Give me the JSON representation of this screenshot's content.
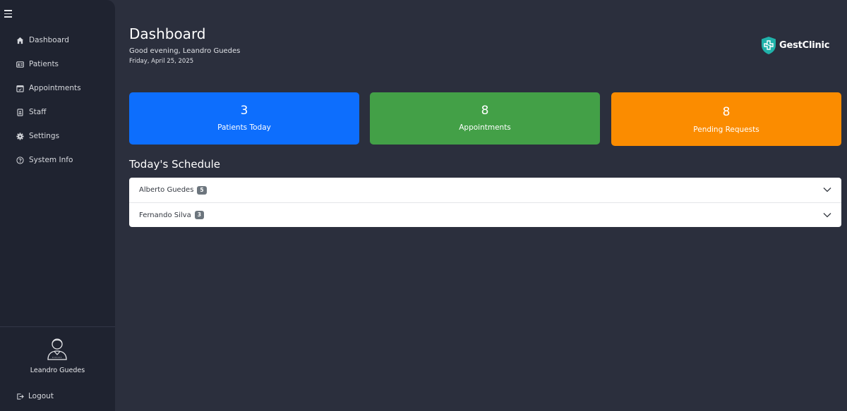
{
  "sidebar": {
    "items": [
      {
        "label": "Dashboard",
        "icon": "home-icon"
      },
      {
        "label": "Patients",
        "icon": "id-card-icon"
      },
      {
        "label": "Appointments",
        "icon": "calendar-icon"
      },
      {
        "label": "Staff",
        "icon": "badge-icon"
      },
      {
        "label": "Settings",
        "icon": "gear-icon"
      },
      {
        "label": "System Info",
        "icon": "help-circle-icon"
      }
    ],
    "user": {
      "name": "Leandro Guedes"
    },
    "logout_label": "Logout"
  },
  "header": {
    "title": "Dashboard",
    "greeting": "Good evening, Leandro Guedes",
    "date": "Friday, April 25, 2025",
    "brand": "GestClinic"
  },
  "stats": [
    {
      "value": "3",
      "label": "Patients Today",
      "color": "#0d6efd"
    },
    {
      "value": "8",
      "label": "Appointments",
      "color": "#43a047"
    },
    {
      "value": "8",
      "label": "Pending Requests",
      "color": "#fb8c00"
    }
  ],
  "schedule": {
    "title": "Today's Schedule",
    "rows": [
      {
        "name": "Alberto Guedes",
        "count": "5"
      },
      {
        "name": "Fernando Silva",
        "count": "3"
      }
    ]
  }
}
